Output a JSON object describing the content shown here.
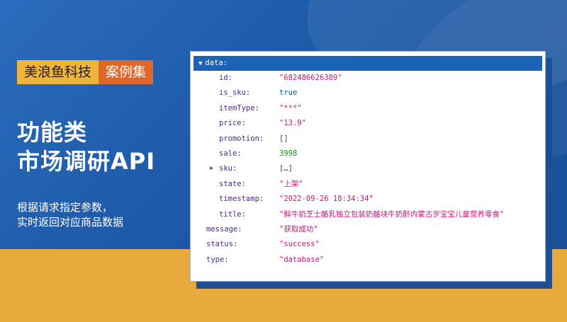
{
  "brand": {
    "company": "美浪鱼科技",
    "tag": "案例集"
  },
  "headline": {
    "line1": "功能类",
    "line2": "市场调研API"
  },
  "description": {
    "line1": "根据请求指定参数，",
    "line2": "实时返回对应商品数据"
  },
  "json_view": {
    "root_key": "data:",
    "fields": [
      {
        "key": "id:",
        "value": "\"682486626389\"",
        "type": "string"
      },
      {
        "key": "is_sku:",
        "value": "true",
        "type": "bool"
      },
      {
        "key": "itemType:",
        "value": "\"***\"",
        "type": "string"
      },
      {
        "key": "price:",
        "value": "\"13.9\"",
        "type": "string"
      },
      {
        "key": "promotion:",
        "value": "[]",
        "type": "plain"
      },
      {
        "key": "sale:",
        "value": "3998",
        "type": "number"
      },
      {
        "key": "sku:",
        "value": "[…]",
        "type": "plain",
        "collapsed": true
      },
      {
        "key": "state:",
        "value": "\"上架\"",
        "type": "string"
      },
      {
        "key": "timestamp:",
        "value": "\"2022-09-26 18:34:34\"",
        "type": "string"
      },
      {
        "key": "title:",
        "value": "\"鲜牛奶芝士酪乳独立包装奶酪块牛奶酐内蒙古岁宝宝儿童营养零食\"",
        "type": "string"
      }
    ],
    "top_fields": [
      {
        "key": "message:",
        "value": "\"获取成功\"",
        "type": "string"
      },
      {
        "key": "status:",
        "value": "\"success\"",
        "type": "string"
      },
      {
        "key": "type:",
        "value": "\"database\"",
        "type": "string"
      }
    ]
  },
  "colors": {
    "blue_bg": "#1f5fa8",
    "gold_bg": "#e8a93c",
    "brand_yellow": "#f2b33d",
    "brand_orange": "#e0672a",
    "header_blue": "#1d63b5",
    "key_color": "#4a2a8a",
    "string_color": "#c5187a",
    "number_color": "#1a8a1a"
  }
}
